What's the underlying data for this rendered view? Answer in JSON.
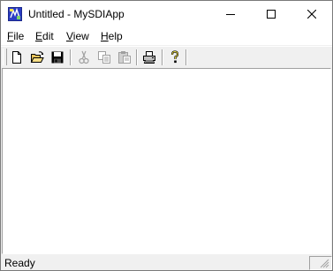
{
  "window": {
    "title": "Untitled - MySDIApp",
    "app_icon": "mfc-app-icon",
    "controls": {
      "minimize_icon": "minimize-icon",
      "maximize_icon": "maximize-icon",
      "close_icon": "close-icon"
    }
  },
  "menu": {
    "items": [
      {
        "mnemonic": "F",
        "rest": "ile"
      },
      {
        "mnemonic": "E",
        "rest": "dit"
      },
      {
        "mnemonic": "V",
        "rest": "iew"
      },
      {
        "mnemonic": "H",
        "rest": "elp"
      }
    ]
  },
  "toolbar": {
    "buttons": [
      {
        "icon": "new-document-icon",
        "enabled": true
      },
      {
        "icon": "open-folder-icon",
        "enabled": true
      },
      {
        "icon": "save-disk-icon",
        "enabled": true
      },
      {
        "icon": "cut-scissors-icon",
        "enabled": false
      },
      {
        "icon": "copy-icon",
        "enabled": false
      },
      {
        "icon": "paste-icon",
        "enabled": false
      },
      {
        "icon": "print-icon",
        "enabled": true
      },
      {
        "icon": "help-about-icon",
        "enabled": true
      }
    ]
  },
  "statusbar": {
    "text": "Ready"
  },
  "colors": {
    "window_bg": "#f0f0f0",
    "client_bg": "#ffffff",
    "titlebar_bg": "#ffffff",
    "disabled_icon": "#a0a0a0"
  }
}
